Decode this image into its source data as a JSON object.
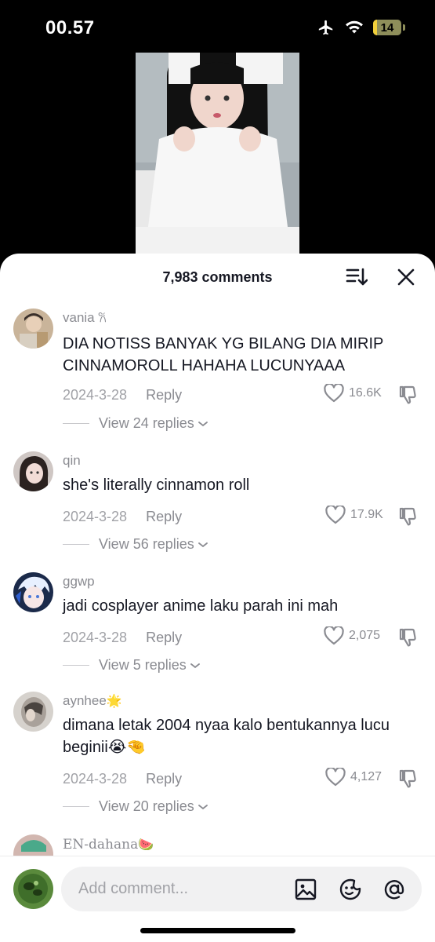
{
  "status_bar": {
    "time": "00.57",
    "battery": "14",
    "battery_level": 0.14
  },
  "sheet": {
    "title": "7,983 comments",
    "sort_icon": "sort-icon",
    "close_icon": "close-icon"
  },
  "comments": [
    {
      "user": "vania",
      "badge": "𐙚",
      "text": "DIA NOTISS BANYAK YG BILANG DIA MIRIP CINNAMOROLL HAHAHA LUCUNYAAA",
      "date": "2024-3-28",
      "reply_label": "Reply",
      "likes": "16.6K",
      "replies": "View 24 replies"
    },
    {
      "user": "qin",
      "badge": "",
      "text": "she's literally cinnamon roll",
      "date": "2024-3-28",
      "reply_label": "Reply",
      "likes": "17.9K",
      "replies": "View 56 replies"
    },
    {
      "user": "ggwp",
      "badge": "",
      "text": "jadi cosplayer anime laku parah ini mah",
      "date": "2024-3-28",
      "reply_label": "Reply",
      "likes": "2,075",
      "replies": "View 5 replies"
    },
    {
      "user": "aynhee",
      "badge": "🌟",
      "text": "dimana letak 2004 nyaa kalo bentukannya lucu beginii😭🤏",
      "date": "2024-3-28",
      "reply_label": "Reply",
      "likes": "4,127",
      "replies": "View 20 replies"
    },
    {
      "user": "EN-dahana",
      "badge": "🍉"
    }
  ],
  "composer": {
    "placeholder": "Add comment...",
    "icons": [
      "image-icon",
      "sticker-icon",
      "mention-icon"
    ]
  }
}
